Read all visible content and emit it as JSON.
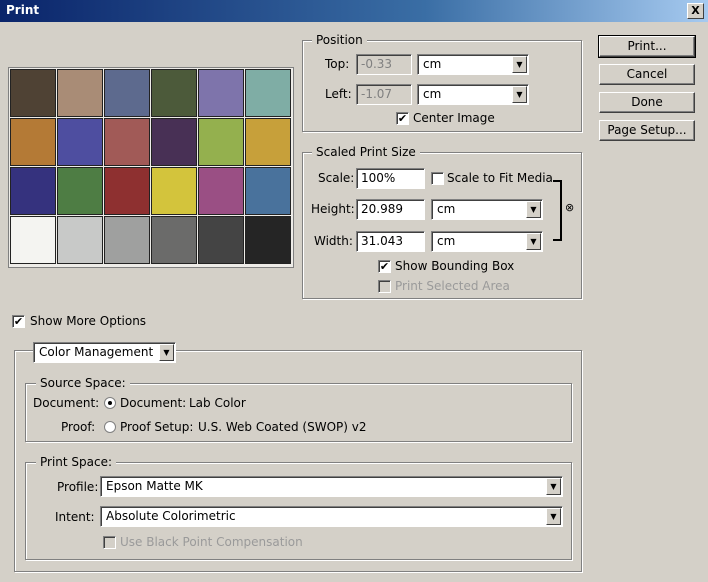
{
  "window": {
    "title": "Print",
    "close_glyph": "X"
  },
  "preview": {
    "swatches": [
      [
        "#4f4234",
        "#a98c76",
        "#5d6a8e",
        "#4c5a3a",
        "#7e74ab",
        "#7fada5"
      ],
      [
        "#b47a36",
        "#4e4ea0",
        "#a15a57",
        "#483055",
        "#94b04e",
        "#c7a03a"
      ],
      [
        "#35327e",
        "#4e7d44",
        "#8e3030",
        "#d3c43c",
        "#9a4f84",
        "#49729c"
      ],
      [
        "#f4f4f1",
        "#c8c9c8",
        "#9fa09f",
        "#6b6b6a",
        "#444444",
        "#252525"
      ]
    ]
  },
  "position": {
    "legend": "Position",
    "top_label": "Top:",
    "top_value": "-0.33",
    "top_unit": "cm",
    "left_label": "Left:",
    "left_value": "-1.07",
    "left_unit": "cm",
    "center_label": "Center Image",
    "center_checked": "✔"
  },
  "scaled": {
    "legend": "Scaled Print Size",
    "scale_label": "Scale:",
    "scale_value": "100%",
    "fit_label": "Scale to Fit Media",
    "height_label": "Height:",
    "height_value": "20.989",
    "height_unit": "cm",
    "width_label": "Width:",
    "width_value": "31.043",
    "width_unit": "cm",
    "bbox_label": "Show Bounding Box",
    "bbox_checked": "✔",
    "selected_label": "Print Selected Area",
    "link_icon": "⊗"
  },
  "buttons": {
    "print": "Print...",
    "cancel": "Cancel",
    "done": "Done",
    "page_setup": "Page Setup..."
  },
  "more_options": {
    "label": "Show More Options",
    "checked": "✔"
  },
  "color_mgmt": {
    "dropdown": "Color Management",
    "source": {
      "legend": "Source Space:",
      "document_label": "Document:",
      "document_option": "Document:",
      "document_value": "Lab Color",
      "proof_label": "Proof:",
      "proof_option": "Proof Setup:",
      "proof_value": "U.S. Web Coated (SWOP) v2"
    },
    "print_space": {
      "legend": "Print Space:",
      "profile_label": "Profile:",
      "profile_value": "Epson Matte MK",
      "intent_label": "Intent:",
      "intent_value": "Absolute Colorimetric",
      "bpc_label": "Use Black Point Compensation"
    }
  },
  "icons": {
    "dropdown_arrow": "▼"
  }
}
